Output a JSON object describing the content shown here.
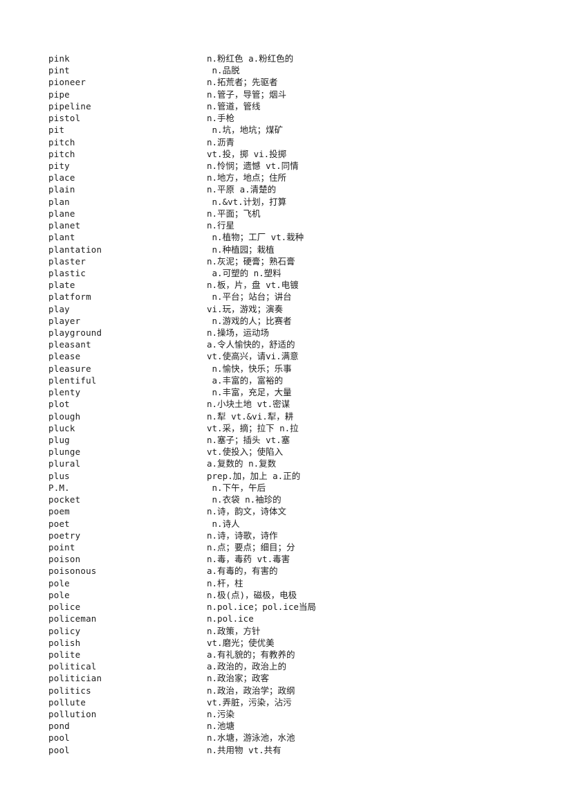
{
  "document": {
    "type": "vocabulary-word-list",
    "section_letter": "P",
    "columns": {
      "term": "word",
      "definition": "part-of-speech and Chinese meaning"
    },
    "colors": {
      "background": "#ffffff",
      "text": "#1c1c1c"
    },
    "entries": [
      {
        "term": "pink",
        "definition": "n.粉红色 a.粉红色的"
      },
      {
        "term": "pint",
        "definition": " n.品脱"
      },
      {
        "term": "pioneer",
        "definition": "n.拓荒者；先驱者"
      },
      {
        "term": "pipe",
        "definition": "n.管子，导管；烟斗"
      },
      {
        "term": "pipeline",
        "definition": "n.管道，管线"
      },
      {
        "term": "pistol",
        "definition": "n.手枪"
      },
      {
        "term": "pit",
        "definition": " n.坑，地坑；煤矿"
      },
      {
        "term": "pitch",
        "definition": "n.沥青"
      },
      {
        "term": "pitch",
        "definition": "vt.投，掷 vi.投掷"
      },
      {
        "term": "pity",
        "definition": "n.怜悯；遗憾 vt.同情"
      },
      {
        "term": "place",
        "definition": "n.地方，地点；住所"
      },
      {
        "term": "plain",
        "definition": "n.平原 a.清楚的"
      },
      {
        "term": "plan",
        "definition": " n.&vt.计划，打算"
      },
      {
        "term": "plane",
        "definition": "n.平面；飞机"
      },
      {
        "term": "planet",
        "definition": "n.行星"
      },
      {
        "term": "plant",
        "definition": " n.植物；工厂 vt.栽种"
      },
      {
        "term": "plantation",
        "definition": " n.种植园；栽植"
      },
      {
        "term": "plaster",
        "definition": "n.灰泥；硬膏；熟石膏"
      },
      {
        "term": "plastic",
        "definition": " a.可塑的 n.塑料"
      },
      {
        "term": "plate",
        "definition": "n.板，片，盘 vt.电镀"
      },
      {
        "term": "platform",
        "definition": " n.平台；站台；讲台"
      },
      {
        "term": "play",
        "definition": "vi.玩，游戏；演奏"
      },
      {
        "term": "player",
        "definition": " n.游戏的人；比赛者"
      },
      {
        "term": "playground",
        "definition": "n.操场，运动场"
      },
      {
        "term": "pleasant",
        "definition": "a.令人愉快的，舒适的"
      },
      {
        "term": "please",
        "definition": "vt.使高兴，请vi.满意"
      },
      {
        "term": "pleasure",
        "definition": " n.愉快，快乐；乐事"
      },
      {
        "term": "plentiful",
        "definition": " a.丰富的，富裕的"
      },
      {
        "term": "plenty",
        "definition": " n.丰富，充足，大量"
      },
      {
        "term": "plot",
        "definition": "n.小块土地 vt.密谋"
      },
      {
        "term": "plough",
        "definition": "n.犁 vt.&vi.犁，耕"
      },
      {
        "term": "pluck",
        "definition": "vt.采，摘；拉下 n.拉"
      },
      {
        "term": "plug",
        "definition": "n.塞子；插头 vt.塞"
      },
      {
        "term": "plunge",
        "definition": "vt.使投入；使陷入"
      },
      {
        "term": "plural",
        "definition": "a.复数的 n.复数"
      },
      {
        "term": "plus",
        "definition": "prep.加，加上 a.正的"
      },
      {
        "term": "P.M.",
        "definition": " n.下午，午后"
      },
      {
        "term": "pocket",
        "definition": " n.衣袋 n.袖珍的"
      },
      {
        "term": "poem",
        "definition": "n.诗，韵文，诗体文"
      },
      {
        "term": "poet",
        "definition": " n.诗人"
      },
      {
        "term": "poetry",
        "definition": "n.诗，诗歌，诗作"
      },
      {
        "term": "point",
        "definition": "n.点；要点；细目；分"
      },
      {
        "term": "poison",
        "definition": "n.毒，毒药 vt.毒害"
      },
      {
        "term": "poisonous",
        "definition": "a.有毒的，有害的"
      },
      {
        "term": "pole",
        "definition": "n.杆，柱"
      },
      {
        "term": "pole",
        "definition": "n.极(点)，磁极，电极"
      },
      {
        "term": "police",
        "definition": "n.pol.ice；pol.ice当局"
      },
      {
        "term": "policeman",
        "definition": "n.pol.ice"
      },
      {
        "term": "policy",
        "definition": "n.政策，方针"
      },
      {
        "term": "polish",
        "definition": "vt.磨光；使优美"
      },
      {
        "term": "polite",
        "definition": "a.有礼貌的；有教养的"
      },
      {
        "term": "political",
        "definition": "a.政治的，政治上的"
      },
      {
        "term": "politician",
        "definition": "n.政治家；政客"
      },
      {
        "term": "politics",
        "definition": "n.政治，政治学；政纲"
      },
      {
        "term": "pollute",
        "definition": "vt.弄脏，污染，沾污"
      },
      {
        "term": "pollution",
        "definition": "n.污染"
      },
      {
        "term": "pond",
        "definition": "n.池塘"
      },
      {
        "term": "pool",
        "definition": "n.水塘，游泳池，水池"
      },
      {
        "term": "pool",
        "definition": "n.共用物 vt.共有"
      }
    ]
  }
}
